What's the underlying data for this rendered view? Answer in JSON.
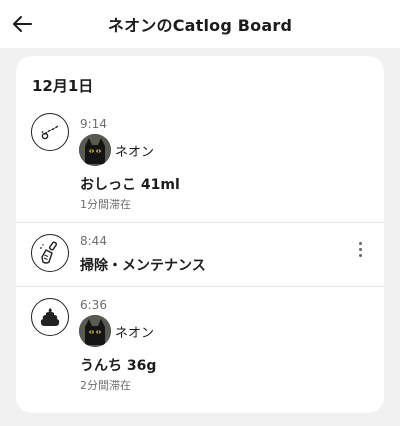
{
  "header": {
    "title": "ネオンのCatlog Board",
    "back_icon": "arrow-left-icon"
  },
  "card": {
    "date": "12月1日",
    "entries": [
      {
        "icon": "urine-drops-icon",
        "time": "9:14",
        "user": "ネオン",
        "text": "おしっこ 41ml",
        "sub": "1分間滞在"
      },
      {
        "icon": "cleaning-scoop-icon",
        "time": "8:44",
        "text": "掃除・メンテナンス",
        "more_icon": "more-vertical-icon"
      },
      {
        "icon": "poop-icon",
        "time": "6:36",
        "user": "ネオン",
        "text": "うんち 36g",
        "sub": "2分間滞在"
      }
    ]
  },
  "colors": {
    "background": "#f1f1f1",
    "card": "#ffffff",
    "text": "#1c1c1c",
    "secondary_text": "#6e6e6e"
  }
}
